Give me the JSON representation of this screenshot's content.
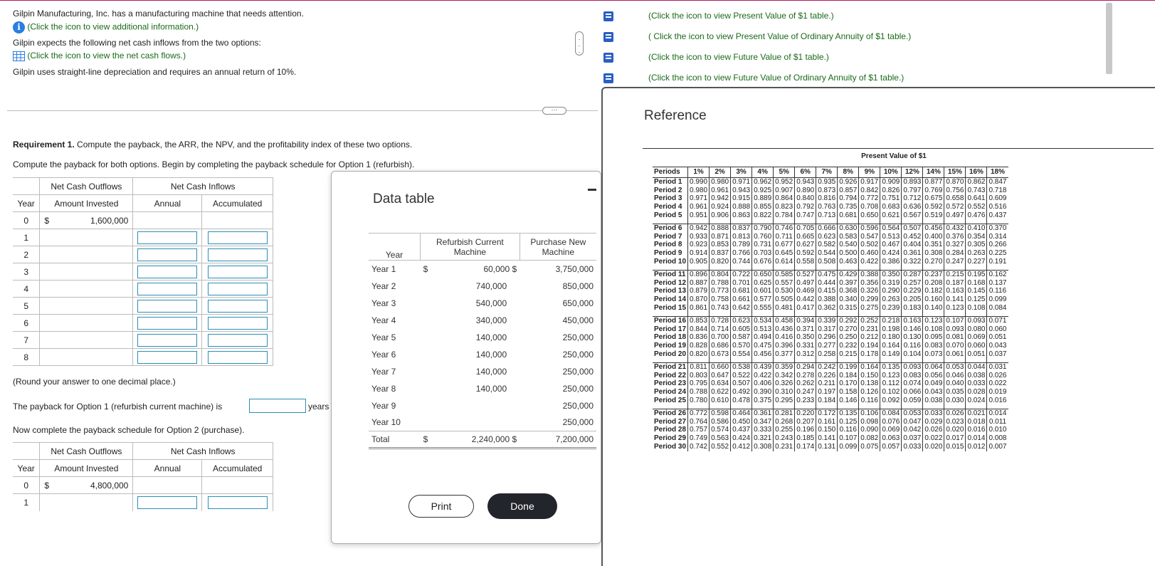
{
  "problem": {
    "line1": "Gilpin Manufacturing, Inc. has a manufacturing machine that needs attention.",
    "info_link": "(Click the icon to view additional information.)",
    "line2": "Gilpin expects the following net cash inflows from the two options:",
    "cash_link": "(Click the icon to view the net cash flows.)",
    "line3": "Gilpin uses straight-line depreciation and requires an annual return of 10%."
  },
  "req": {
    "label": "Requirement 1.",
    "text": " Compute the payback, the ARR, the NPV, and the profitability index of these two options.",
    "instruction": "Compute the payback for both options. Begin by completing the payback schedule for Option 1 (refurbish).",
    "round_note": "(Round your answer to one decimal place.)",
    "payback1_text": "The payback for Option 1 (refurbish current machine) is",
    "years_unit": "years",
    "option2_text": "Now complete the payback schedule for Option 2 (purchase)."
  },
  "schedule": {
    "h_outflows": "Net Cash Outflows",
    "h_inflows": "Net Cash Inflows",
    "h_year": "Year",
    "h_amount": "Amount Invested",
    "h_annual": "Annual",
    "h_accum": "Accumulated",
    "currency": "$",
    "opt1_years": [
      "0",
      "1",
      "2",
      "3",
      "4",
      "5",
      "6",
      "7",
      "8"
    ],
    "opt1_invest": "1,600,000",
    "opt2_years": [
      "0",
      "1"
    ],
    "opt2_invest": "4,800,000"
  },
  "data_table": {
    "title": "Data table",
    "h_year": "Year",
    "h_refurb": "Refurbish Current Machine",
    "h_purchase": "Purchase New Machine",
    "currency": "$",
    "rows": [
      {
        "year": "Year 1",
        "refurb": "60,000",
        "purchase": "3,750,000"
      },
      {
        "year": "Year 2",
        "refurb": "740,000",
        "purchase": "850,000"
      },
      {
        "year": "Year 3",
        "refurb": "540,000",
        "purchase": "650,000"
      },
      {
        "year": "Year 4",
        "refurb": "340,000",
        "purchase": "450,000"
      },
      {
        "year": "Year 5",
        "refurb": "140,000",
        "purchase": "250,000"
      },
      {
        "year": "Year 6",
        "refurb": "140,000",
        "purchase": "250,000"
      },
      {
        "year": "Year 7",
        "refurb": "140,000",
        "purchase": "250,000"
      },
      {
        "year": "Year 8",
        "refurb": "140,000",
        "purchase": "250,000"
      },
      {
        "year": "Year 9",
        "refurb": "",
        "purchase": "250,000"
      },
      {
        "year": "Year 10",
        "refurb": "",
        "purchase": "250,000"
      }
    ],
    "total_label": "Total",
    "total_refurb": "2,240,000",
    "total_purchase": "7,200,000",
    "print_label": "Print",
    "done_label": "Done"
  },
  "resource_links": [
    "(Click the icon to view Present Value of $1 table.)",
    "( Click the icon to view Present Value of Ordinary Annuity of $1 table.)",
    "(Click the icon to view Future Value of $1 table.)",
    "(Click the icon to view Future Value of Ordinary Annuity of $1 table.)"
  ],
  "reference": {
    "title": "Reference",
    "table_title": "Present Value of $1",
    "h_periods": "Periods",
    "rates": [
      "1%",
      "2%",
      "3%",
      "4%",
      "5%",
      "6%",
      "7%",
      "8%",
      "9%",
      "10%",
      "12%",
      "14%",
      "15%",
      "16%",
      "18%"
    ],
    "rows": [
      [
        "Period 1",
        "0.990",
        "0.980",
        "0.971",
        "0.962",
        "0.952",
        "0.943",
        "0.935",
        "0.926",
        "0.917",
        "0.909",
        "0.893",
        "0.877",
        "0.870",
        "0.862",
        "0.847"
      ],
      [
        "Period 2",
        "0.980",
        "0.961",
        "0.943",
        "0.925",
        "0.907",
        "0.890",
        "0.873",
        "0.857",
        "0.842",
        "0.826",
        "0.797",
        "0.769",
        "0.756",
        "0.743",
        "0.718"
      ],
      [
        "Period 3",
        "0.971",
        "0.942",
        "0.915",
        "0.889",
        "0.864",
        "0.840",
        "0.816",
        "0.794",
        "0.772",
        "0.751",
        "0.712",
        "0.675",
        "0.658",
        "0.641",
        "0.609"
      ],
      [
        "Period 4",
        "0.961",
        "0.924",
        "0.888",
        "0.855",
        "0.823",
        "0.792",
        "0.763",
        "0.735",
        "0.708",
        "0.683",
        "0.636",
        "0.592",
        "0.572",
        "0.552",
        "0.516"
      ],
      [
        "Period 5",
        "0.951",
        "0.906",
        "0.863",
        "0.822",
        "0.784",
        "0.747",
        "0.713",
        "0.681",
        "0.650",
        "0.621",
        "0.567",
        "0.519",
        "0.497",
        "0.476",
        "0.437"
      ],
      [
        "Period 6",
        "0.942",
        "0.888",
        "0.837",
        "0.790",
        "0.746",
        "0.705",
        "0.666",
        "0.630",
        "0.596",
        "0.564",
        "0.507",
        "0.456",
        "0.432",
        "0.410",
        "0.370"
      ],
      [
        "Period 7",
        "0.933",
        "0.871",
        "0.813",
        "0.760",
        "0.711",
        "0.665",
        "0.623",
        "0.583",
        "0.547",
        "0.513",
        "0.452",
        "0.400",
        "0.376",
        "0.354",
        "0.314"
      ],
      [
        "Period 8",
        "0.923",
        "0.853",
        "0.789",
        "0.731",
        "0.677",
        "0.627",
        "0.582",
        "0.540",
        "0.502",
        "0.467",
        "0.404",
        "0.351",
        "0.327",
        "0.305",
        "0.266"
      ],
      [
        "Period 9",
        "0.914",
        "0.837",
        "0.766",
        "0.703",
        "0.645",
        "0.592",
        "0.544",
        "0.500",
        "0.460",
        "0.424",
        "0.361",
        "0.308",
        "0.284",
        "0.263",
        "0.225"
      ],
      [
        "Period 10",
        "0.905",
        "0.820",
        "0.744",
        "0.676",
        "0.614",
        "0.558",
        "0.508",
        "0.463",
        "0.422",
        "0.386",
        "0.322",
        "0.270",
        "0.247",
        "0.227",
        "0.191"
      ],
      [
        "Period 11",
        "0.896",
        "0.804",
        "0.722",
        "0.650",
        "0.585",
        "0.527",
        "0.475",
        "0.429",
        "0.388",
        "0.350",
        "0.287",
        "0.237",
        "0.215",
        "0.195",
        "0.162"
      ],
      [
        "Period 12",
        "0.887",
        "0.788",
        "0.701",
        "0.625",
        "0.557",
        "0.497",
        "0.444",
        "0.397",
        "0.356",
        "0.319",
        "0.257",
        "0.208",
        "0.187",
        "0.168",
        "0.137"
      ],
      [
        "Period 13",
        "0.879",
        "0.773",
        "0.681",
        "0.601",
        "0.530",
        "0.469",
        "0.415",
        "0.368",
        "0.326",
        "0.290",
        "0.229",
        "0.182",
        "0.163",
        "0.145",
        "0.116"
      ],
      [
        "Period 14",
        "0.870",
        "0.758",
        "0.661",
        "0.577",
        "0.505",
        "0.442",
        "0.388",
        "0.340",
        "0.299",
        "0.263",
        "0.205",
        "0.160",
        "0.141",
        "0.125",
        "0.099"
      ],
      [
        "Period 15",
        "0.861",
        "0.743",
        "0.642",
        "0.555",
        "0.481",
        "0.417",
        "0.362",
        "0.315",
        "0.275",
        "0.239",
        "0.183",
        "0.140",
        "0.123",
        "0.108",
        "0.084"
      ],
      [
        "Period 16",
        "0.853",
        "0.728",
        "0.623",
        "0.534",
        "0.458",
        "0.394",
        "0.339",
        "0.292",
        "0.252",
        "0.218",
        "0.163",
        "0.123",
        "0.107",
        "0.093",
        "0.071"
      ],
      [
        "Period 17",
        "0.844",
        "0.714",
        "0.605",
        "0.513",
        "0.436",
        "0.371",
        "0.317",
        "0.270",
        "0.231",
        "0.198",
        "0.146",
        "0.108",
        "0.093",
        "0.080",
        "0.060"
      ],
      [
        "Period 18",
        "0.836",
        "0.700",
        "0.587",
        "0.494",
        "0.416",
        "0.350",
        "0.296",
        "0.250",
        "0.212",
        "0.180",
        "0.130",
        "0.095",
        "0.081",
        "0.069",
        "0.051"
      ],
      [
        "Period 19",
        "0.828",
        "0.686",
        "0.570",
        "0.475",
        "0.396",
        "0.331",
        "0.277",
        "0.232",
        "0.194",
        "0.164",
        "0.116",
        "0.083",
        "0.070",
        "0.060",
        "0.043"
      ],
      [
        "Period 20",
        "0.820",
        "0.673",
        "0.554",
        "0.456",
        "0.377",
        "0.312",
        "0.258",
        "0.215",
        "0.178",
        "0.149",
        "0.104",
        "0.073",
        "0.061",
        "0.051",
        "0.037"
      ],
      [
        "Period 21",
        "0.811",
        "0.660",
        "0.538",
        "0.439",
        "0.359",
        "0.294",
        "0.242",
        "0.199",
        "0.164",
        "0.135",
        "0.093",
        "0.064",
        "0.053",
        "0.044",
        "0.031"
      ],
      [
        "Period 22",
        "0.803",
        "0.647",
        "0.522",
        "0.422",
        "0.342",
        "0.278",
        "0.226",
        "0.184",
        "0.150",
        "0.123",
        "0.083",
        "0.056",
        "0.046",
        "0.038",
        "0.026"
      ],
      [
        "Period 23",
        "0.795",
        "0.634",
        "0.507",
        "0.406",
        "0.326",
        "0.262",
        "0.211",
        "0.170",
        "0.138",
        "0.112",
        "0.074",
        "0.049",
        "0.040",
        "0.033",
        "0.022"
      ],
      [
        "Period 24",
        "0.788",
        "0.622",
        "0.492",
        "0.390",
        "0.310",
        "0.247",
        "0.197",
        "0.158",
        "0.126",
        "0.102",
        "0.066",
        "0.043",
        "0.035",
        "0.028",
        "0.019"
      ],
      [
        "Period 25",
        "0.780",
        "0.610",
        "0.478",
        "0.375",
        "0.295",
        "0.233",
        "0.184",
        "0.146",
        "0.116",
        "0.092",
        "0.059",
        "0.038",
        "0.030",
        "0.024",
        "0.016"
      ],
      [
        "Period 26",
        "0.772",
        "0.598",
        "0.464",
        "0.361",
        "0.281",
        "0.220",
        "0.172",
        "0.135",
        "0.106",
        "0.084",
        "0.053",
        "0.033",
        "0.026",
        "0.021",
        "0.014"
      ],
      [
        "Period 27",
        "0.764",
        "0.586",
        "0.450",
        "0.347",
        "0.268",
        "0.207",
        "0.161",
        "0.125",
        "0.098",
        "0.076",
        "0.047",
        "0.029",
        "0.023",
        "0.018",
        "0.011"
      ],
      [
        "Period 28",
        "0.757",
        "0.574",
        "0.437",
        "0.333",
        "0.255",
        "0.196",
        "0.150",
        "0.116",
        "0.090",
        "0.069",
        "0.042",
        "0.026",
        "0.020",
        "0.016",
        "0.010"
      ],
      [
        "Period 29",
        "0.749",
        "0.563",
        "0.424",
        "0.321",
        "0.243",
        "0.185",
        "0.141",
        "0.107",
        "0.082",
        "0.063",
        "0.037",
        "0.022",
        "0.017",
        "0.014",
        "0.008"
      ],
      [
        "Period 30",
        "0.742",
        "0.552",
        "0.412",
        "0.308",
        "0.231",
        "0.174",
        "0.131",
        "0.099",
        "0.075",
        "0.057",
        "0.033",
        "0.020",
        "0.015",
        "0.012",
        "0.007"
      ]
    ]
  },
  "colors": {
    "link": "#1a6a1a",
    "info_icon": "#2a7de1",
    "input_border": "#2a8fb5",
    "done_button": "#22252b",
    "top_accent": "#b0195c"
  }
}
